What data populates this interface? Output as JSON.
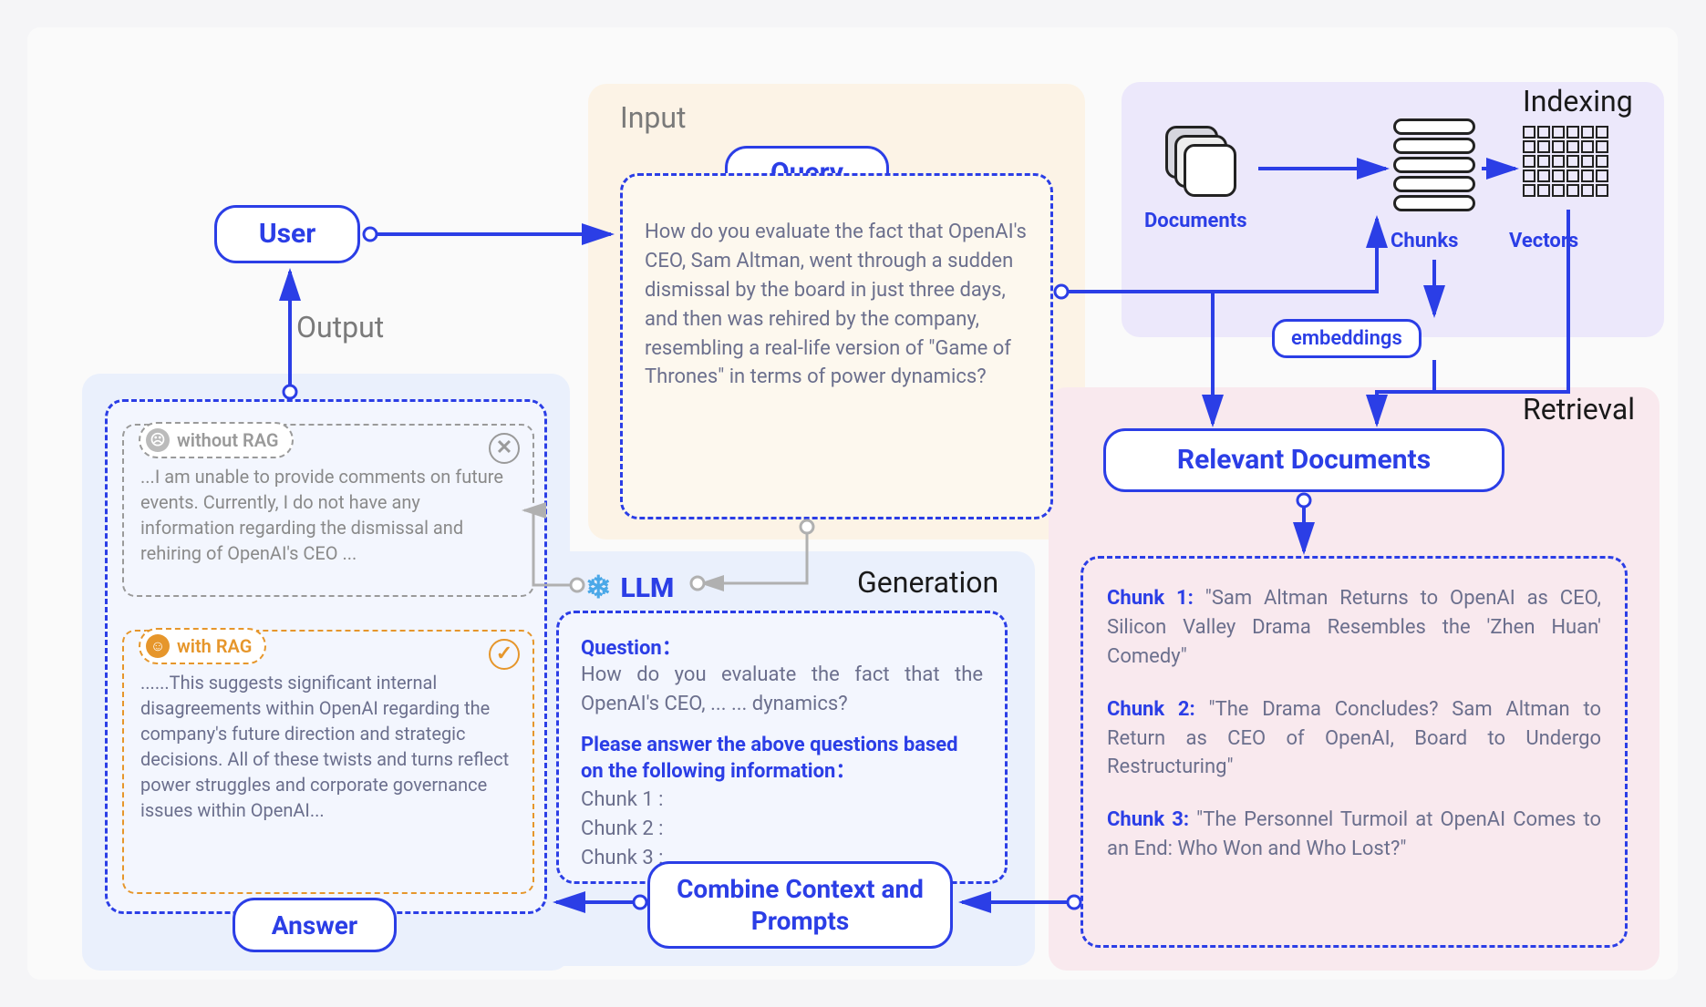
{
  "user": {
    "label": "User"
  },
  "sections": {
    "input": "Input",
    "output": "Output",
    "indexing": "Indexing",
    "retrieval": "Retrieval",
    "generation": "Generation"
  },
  "query": {
    "title": "Query",
    "text": "How do you evaluate the fact that OpenAI's CEO, Sam Altman, went through a sudden dismissal by the board in just three days, and then was rehired by the company, resembling a real-life version of \"Game of Thrones\" in terms of power dynamics?"
  },
  "indexing": {
    "documents": "Documents",
    "chunks": "Chunks",
    "vectors": "Vectors",
    "embeddings": "embeddings"
  },
  "retrieval": {
    "relevant_title": "Relevant Documents",
    "chunks": [
      {
        "label": "Chunk 1:",
        "text": "\"Sam Altman Returns to OpenAI as CEO, Silicon Valley Drama Resembles the 'Zhen Huan' Comedy\""
      },
      {
        "label": "Chunk 2:",
        "text": "\"The Drama Concludes? Sam Altman to Return as CEO of OpenAI, Board to Undergo Restructuring\""
      },
      {
        "label": "Chunk 3:",
        "text": "\"The Personnel Turmoil at OpenAI Comes to an End: Who Won and Who Lost?\""
      }
    ]
  },
  "generation": {
    "llm": "LLM",
    "question_label": "Question：",
    "question_text": "How do you evaluate the fact that the OpenAI's CEO, ... ... dynamics?",
    "instruction": "Please answer the above questions based on the following information：",
    "chunk_lines": [
      "Chunk 1 :",
      "Chunk 2 :",
      "Chunk 3 :"
    ],
    "combine": "Combine Context and Prompts"
  },
  "output": {
    "without_tag": "without RAG",
    "without_text": "...I am unable to provide comments on future events. Currently, I do not have any information regarding the dismissal and rehiring of OpenAI's CEO ...",
    "with_tag": "with RAG",
    "with_text": "......This suggests significant internal disagreements within OpenAI regarding the company's future direction and strategic decisions. All of these twists and turns reflect power struggles and corporate governance issues within OpenAI...",
    "answer": "Answer"
  }
}
